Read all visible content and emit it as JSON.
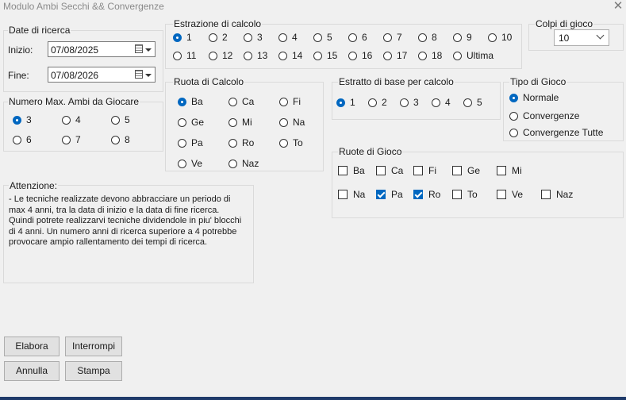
{
  "window": {
    "title": "Modulo Ambi Secchi && Convergenze",
    "close_symbol": "✕"
  },
  "date_ricerca": {
    "legend": "Date di ricerca",
    "inizio_label": "Inizio:",
    "inizio_value": "07/08/2025",
    "fine_label": "Fine:",
    "fine_value": "07/08/2026"
  },
  "numero_ambi": {
    "legend": "Numero Max. Ambi da Giocare",
    "options": [
      "3",
      "4",
      "5",
      "6",
      "7",
      "8"
    ],
    "selected": "3"
  },
  "estrazione": {
    "legend": "Estrazione di calcolo",
    "options": [
      "1",
      "2",
      "3",
      "4",
      "5",
      "6",
      "7",
      "8",
      "9",
      "10",
      "11",
      "12",
      "13",
      "14",
      "15",
      "16",
      "17",
      "18",
      "Ultima"
    ],
    "selected": "1"
  },
  "colpi": {
    "legend": "Colpi di gioco",
    "value": "10"
  },
  "ruota_calcolo": {
    "legend": "Ruota di Calcolo",
    "options": [
      "Ba",
      "Ca",
      "Fi",
      "Ge",
      "Mi",
      "Na",
      "Pa",
      "Ro",
      "To",
      "Ve",
      "Naz"
    ],
    "selected": "Ba"
  },
  "estratto_base": {
    "legend": "Estratto di base per calcolo",
    "options": [
      "1",
      "2",
      "3",
      "4",
      "5"
    ],
    "selected": "1"
  },
  "tipo_gioco": {
    "legend": "Tipo di Gioco",
    "options": [
      "Normale",
      "Convergenze",
      "Convergenze Tutte"
    ],
    "selected": "Normale"
  },
  "ruote_gioco": {
    "legend": "Ruote di Gioco",
    "options": [
      "Ba",
      "Ca",
      "Fi",
      "Ge",
      "Mi",
      "Na",
      "Pa",
      "Ro",
      "To",
      "Ve",
      "Naz"
    ],
    "checked": [
      "Pa",
      "Ro"
    ]
  },
  "attenzione": {
    "label": "Attenzione:",
    "text": "- Le tecniche realizzate devono abbracciare un periodo di max 4 anni, tra la data di inizio e la data di fine ricerca. Quindi potrete realizzarvi tecniche dividendole in piu' blocchi di 4 anni. Un numero anni di ricerca superiore a 4 potrebbe provocare ampio rallentamento dei tempi di ricerca."
  },
  "buttons": {
    "elabora": "Elabora",
    "interrompi": "Interrompi",
    "annulla": "Annulla",
    "stampa": "Stampa"
  }
}
